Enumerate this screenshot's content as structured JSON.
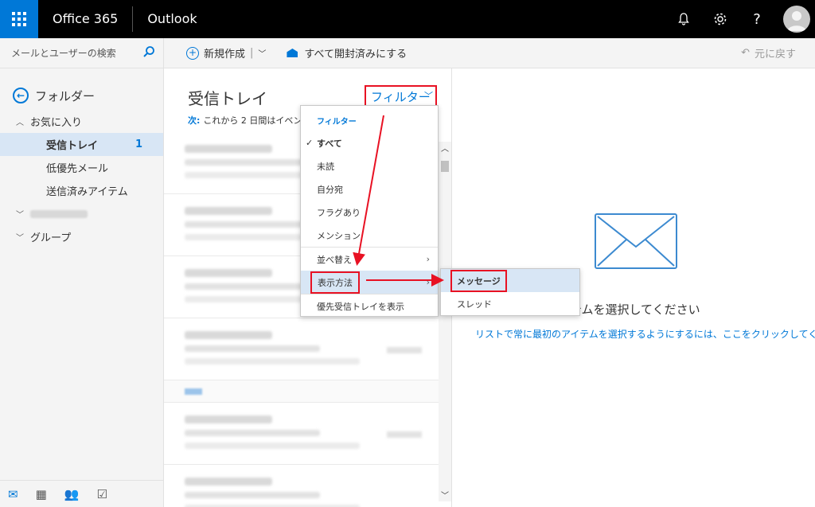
{
  "topbar": {
    "suite_name": "Office 365",
    "app_name": "Outlook",
    "icons": [
      "waffle-icon",
      "bell-icon",
      "gear-icon",
      "help-icon",
      "avatar"
    ],
    "help_glyph": "?"
  },
  "search": {
    "placeholder": "メールとユーザーの検索",
    "icon": "search-icon"
  },
  "commands": {
    "new": "新規作成",
    "new_sep": "|",
    "mark_all_read": "すべて開封済みにする",
    "undo": "元に戻す"
  },
  "folders": {
    "header": "フォルダー",
    "favorites": "お気に入り",
    "items": [
      {
        "label": "受信トレイ",
        "count": "1",
        "selected": true
      },
      {
        "label": "低優先メール"
      },
      {
        "label": "送信済みアイテム"
      }
    ],
    "groups": "グループ"
  },
  "list": {
    "title": "受信トレイ",
    "filter": "フィルター",
    "next_label": "次:",
    "next_text": "これから 2 日間はイベントが"
  },
  "menu": {
    "header": "フィルター",
    "items": [
      "すべて",
      "未読",
      "自分宛",
      "フラグあり",
      "メンション"
    ],
    "sort": "並べ替え",
    "display": "表示方法",
    "focused": "優先受信トレイを表示"
  },
  "submenu": {
    "items": [
      "メッセージ",
      "スレッド"
    ]
  },
  "reading": {
    "select_text": "アイテムを選択してください",
    "link_text": "リストで常に最初のアイテムを選択するようにするには、ここをクリックしてください"
  },
  "colors": {
    "accent": "#0078d7",
    "highlight": "#e81123",
    "selected_bg": "#d8e6f5"
  }
}
